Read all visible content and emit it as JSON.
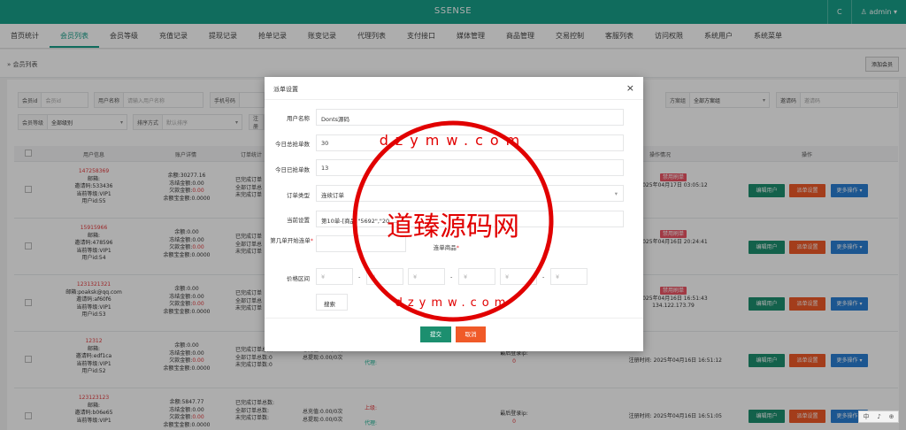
{
  "header": {
    "title": "SSENSE",
    "refresh_label": "C",
    "user": "admin"
  },
  "nav": [
    "首页统计",
    "会员列表",
    "会员等级",
    "充值记录",
    "提现记录",
    "抢单记录",
    "账变记录",
    "代理列表",
    "支付接口",
    "媒体管理",
    "商品管理",
    "交易控制",
    "客服列表",
    "访问权限",
    "系统用户",
    "系统菜单"
  ],
  "breadcrumb": "» 会员列表",
  "add_member": "添加会员",
  "filters": {
    "member_id": {
      "label": "会员id",
      "placeholder": "会员id"
    },
    "username": {
      "label": "用户名称",
      "placeholder": "请输入用户名称"
    },
    "phone": {
      "label": "手机号码"
    },
    "plan": {
      "label": "方案组",
      "value": "全部方案组"
    },
    "invite": {
      "label": "邀请码",
      "placeholder": "邀请码"
    },
    "level": {
      "label": "会员等级",
      "value": "全部级别"
    },
    "sort": {
      "label": "排序方式",
      "placeholder": "默认排序"
    },
    "reg": {
      "label": "注册"
    }
  },
  "table": {
    "headers": [
      "用户信息",
      "账户详情",
      "订单统计",
      "操作情况",
      "操作"
    ],
    "rows": [
      {
        "name": "147258369",
        "l2": "邮箱:",
        "l3": "邀请码:533436",
        "l4": "当前等级:VIP1",
        "l5": "用户id:55",
        "bal": "余额:30277.16",
        "frz": "冻结金额:0.00",
        "owe": "欠款金额:",
        "owev": "0.00",
        "gold": "余额宝金额:0.0000",
        "o1": "已完成订单",
        "o2": "全部订单总",
        "o3": "未完成订单",
        "ban": "禁用刷单",
        "time": "2025年04月17日 03:05:12",
        "ip": ""
      },
      {
        "name": "15915966",
        "l2": "邮箱:",
        "l3": "邀请码:478596",
        "l4": "当前等级:VIP1",
        "l5": "用户id:54",
        "bal": "余额:0.00",
        "frz": "冻结金额:0.00",
        "owe": "欠款金额:",
        "owev": "0.00",
        "gold": "余额宝金额:0.0000",
        "o1": "已完成订单",
        "o2": "全部订单总",
        "o3": "未完成订单",
        "ban": "禁用刷单",
        "time": "2025年04月16日 20:24:41",
        "ip": ""
      },
      {
        "name": "1231321321",
        "l2": "邮箱:poaksk@qq.com",
        "l3": "邀请码:af60f6",
        "l4": "当前等级:VIP1",
        "l5": "用户id:53",
        "bal": "余额:0.00",
        "frz": "冻结金额:0.00",
        "owe": "欠款金额:",
        "owev": "0.00",
        "gold": "余额宝金额:0.0000",
        "o1": "已完成订单",
        "o2": "全部订单总",
        "o3": "未完成订单",
        "ban": "禁用刷单",
        "time": "2025年04月16日 16:51:43",
        "ip": "134.122.173.79"
      },
      {
        "name": "12312",
        "l2": "邮箱:",
        "l3": "邀请码:edf1ca",
        "l4": "当前等级:VIP1",
        "l5": "用户id:52",
        "bal": "余额:0.00",
        "frz": "冻结金额:0.00",
        "owe": "欠款金额:",
        "owev": "0.00",
        "gold": "余额宝金额:0.0000",
        "o1": "已完成订单总数:0",
        "o2": "全部订单总数:0",
        "o3": "未完成订单数:0",
        "mid1": "总充值:0.00/0次",
        "mid2": "总提现:0.00/0次",
        "up": "上级:",
        "agent": "代理:",
        "login": "最后登录ip:",
        "loginv": "0",
        "reg": "注册时间:",
        "time": "2025年04月16日 16:51:12",
        "ip": ""
      },
      {
        "name": "123123123",
        "l2": "邮箱:",
        "l3": "邀请码:b06e65",
        "l4": "当前等级:VIP1",
        "l5": "",
        "bal": "余额:5847.77",
        "frz": "冻结金额:0.00",
        "owe": "欠款金额:",
        "owev": "0.00",
        "gold": "余额宝金额:0.0000",
        "o1": "已完成订单总数:",
        "o2": "全部订单总数:",
        "o3": "未完成订单数:",
        "mid1": "总充值:0.00/0次",
        "mid2": "总提现:0.00/0次",
        "up": "上级:",
        "agent": "代理:",
        "login": "最后登录ip:",
        "loginv": "0",
        "reg": "注册时间:",
        "time": "2025年04月16日 16:51:05",
        "ip": ""
      }
    ],
    "edit_label": "编辑用户",
    "dispatch_label": "派单设置",
    "more_label": "更多操作 ▾"
  },
  "modal": {
    "title": "派单设置",
    "username_label": "用户名称",
    "username_value": "Donts源码",
    "today_total_label": "今日总抢单数",
    "today_total_value": "30",
    "today_done_label": "今日已抢单数",
    "today_done_value": "13",
    "type_label": "订单类型",
    "type_value": "连续订单",
    "current_label": "当前设置",
    "current_value": "第10单-[商品:\"5692\",\"20 ...",
    "start_label": "第几单开始连单",
    "goods_label": "连单商品",
    "price_label": "价格区间",
    "price_ph": "¥",
    "dash": "-",
    "search_label": "搜索",
    "submit_label": "提交",
    "cancel_label": "取消"
  },
  "watermark": {
    "text": "道臻源码网",
    "ring": "dzymw.com"
  },
  "lang": [
    "中",
    "♪",
    "⊕"
  ]
}
